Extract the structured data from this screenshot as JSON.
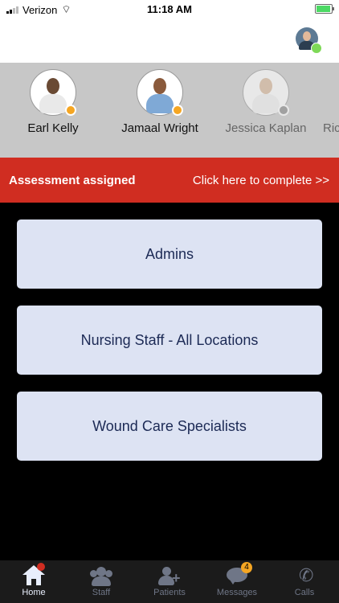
{
  "status_bar": {
    "carrier": "Verizon",
    "time": "11:18 AM"
  },
  "staff": [
    {
      "name": "Earl Kelly",
      "status_color": "#f5a623"
    },
    {
      "name": "Jamaal Wright",
      "status_color": "#f5a623"
    },
    {
      "name": "Jessica Kaplan",
      "status_color": "#888888"
    },
    {
      "name": "Ric"
    }
  ],
  "banner": {
    "title": "Assessment assigned",
    "action": "Click here to complete >>"
  },
  "groups": [
    {
      "label": "Admins"
    },
    {
      "label": "Nursing Staff - All Locations"
    },
    {
      "label": "Wound Care Specialists"
    }
  ],
  "tabs": [
    {
      "label": "Home",
      "icon": "home-icon"
    },
    {
      "label": "Staff",
      "icon": "staff-icon"
    },
    {
      "label": "Patients",
      "icon": "patients-icon"
    },
    {
      "label": "Messages",
      "icon": "messages-icon",
      "badge": "4"
    },
    {
      "label": "Calls",
      "icon": "phone-icon"
    }
  ],
  "colors": {
    "banner": "#d02d21",
    "card": "#dde3f3",
    "card_text": "#1c2a55",
    "online_badge": "#7ed957"
  }
}
